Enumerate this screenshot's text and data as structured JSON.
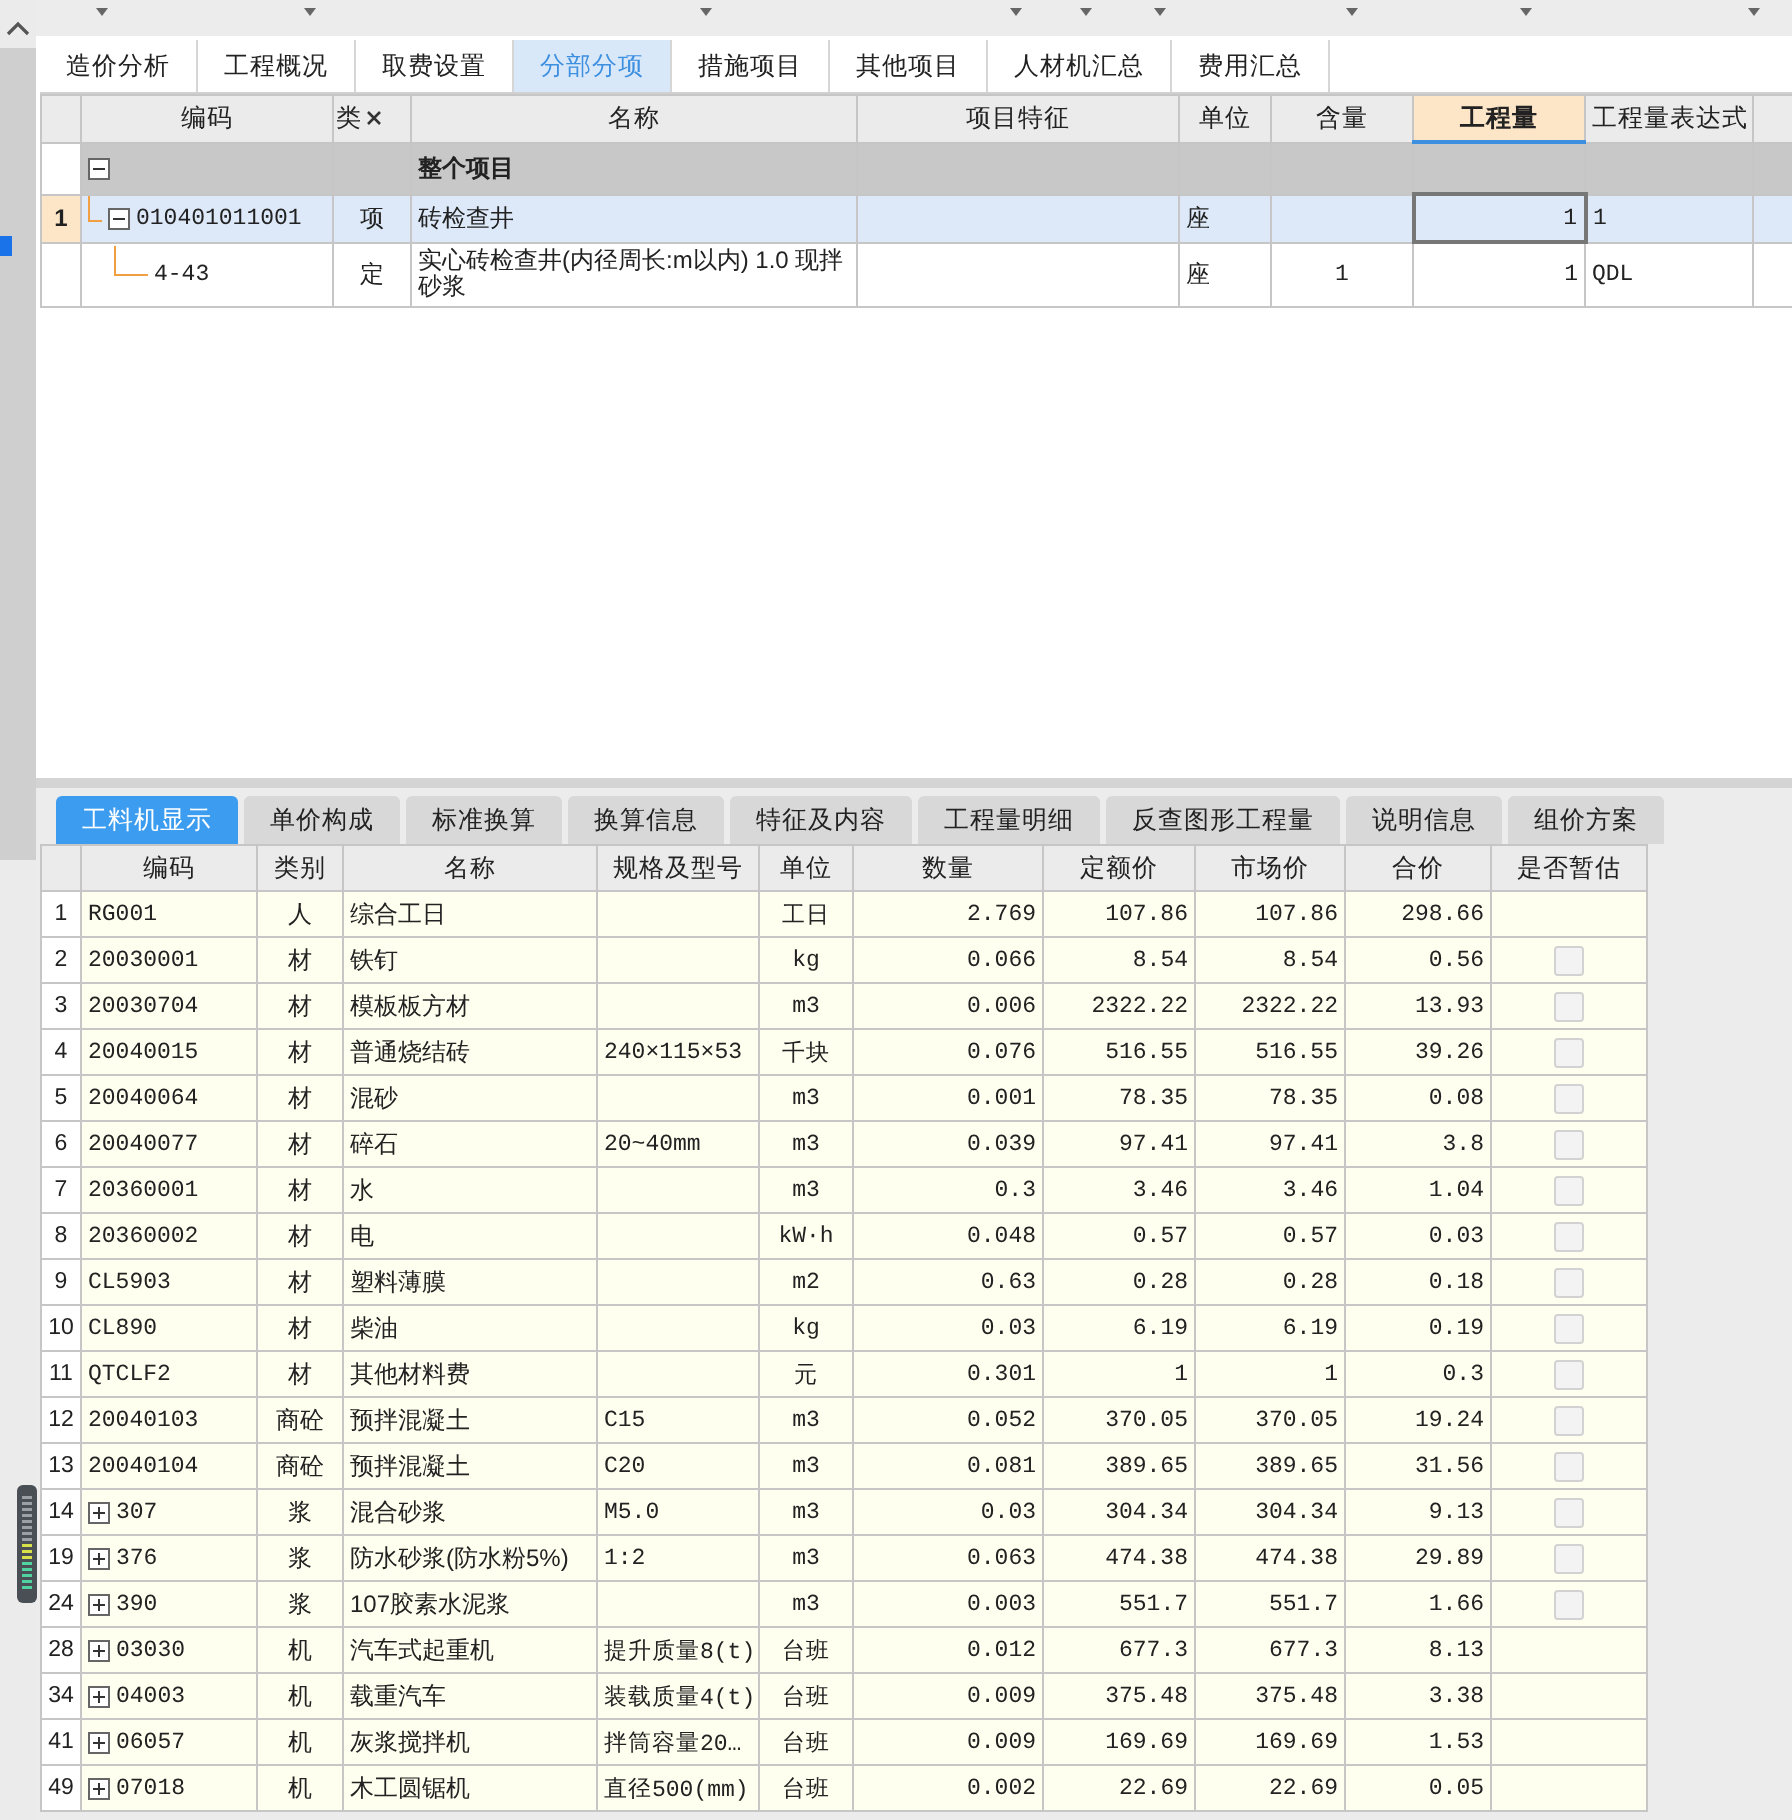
{
  "top_tabs": [
    {
      "label": "造价分析",
      "selected": false
    },
    {
      "label": "工程概况",
      "selected": false
    },
    {
      "label": "取费设置",
      "selected": false
    },
    {
      "label": "分部分项",
      "selected": true
    },
    {
      "label": "措施项目",
      "selected": false
    },
    {
      "label": "其他项目",
      "selected": false
    },
    {
      "label": "人材机汇总",
      "selected": false
    },
    {
      "label": "费用汇总",
      "selected": false
    }
  ],
  "upper_grid": {
    "columns": [
      {
        "label": "编码",
        "selected": false,
        "closable": false
      },
      {
        "label": "类",
        "selected": false,
        "closable": true
      },
      {
        "label": "名称",
        "selected": false,
        "closable": false
      },
      {
        "label": "项目特征",
        "selected": false,
        "closable": false
      },
      {
        "label": "单位",
        "selected": false,
        "closable": false
      },
      {
        "label": "含量",
        "selected": false,
        "closable": false
      },
      {
        "label": "工程量",
        "selected": true,
        "closable": false
      },
      {
        "label": "工程量表达式",
        "selected": false,
        "closable": false
      }
    ],
    "rows": [
      {
        "kind": "group",
        "expanded": true,
        "selected": false,
        "name": "整个项目"
      },
      {
        "kind": "item",
        "expanded": true,
        "selected": true,
        "row_number": "1",
        "code": "010401011001",
        "type": "项",
        "name": "砖检查井",
        "unit": "座",
        "quantity": "1",
        "expression": "1"
      },
      {
        "kind": "child",
        "selected": false,
        "code": "4-43",
        "type": "定",
        "name": "实心砖检查井(内径周长:m以内) 1.0 现拌砂浆",
        "unit": "座",
        "content": "1",
        "quantity": "1",
        "expression": "QDL"
      }
    ]
  },
  "bottom_tabs": [
    {
      "label": "工料机显示",
      "selected": true
    },
    {
      "label": "单价构成",
      "selected": false
    },
    {
      "label": "标准换算",
      "selected": false
    },
    {
      "label": "换算信息",
      "selected": false
    },
    {
      "label": "特征及内容",
      "selected": false
    },
    {
      "label": "工程量明细",
      "selected": false
    },
    {
      "label": "反查图形工程量",
      "selected": false
    },
    {
      "label": "说明信息",
      "selected": false
    },
    {
      "label": "组价方案",
      "selected": false
    }
  ],
  "lower_grid": {
    "columns": [
      "编码",
      "类别",
      "名称",
      "规格及型号",
      "单位",
      "数量",
      "定额价",
      "市场价",
      "合价",
      "是否暂估"
    ],
    "rows": [
      {
        "number": "1",
        "code": "RG001",
        "type": "人",
        "name": "综合工日",
        "unit": "工日",
        "amount": "2.769",
        "quota_price": "107.86",
        "market_price": "107.86",
        "total": "298.66"
      },
      {
        "number": "2",
        "code": "20030001",
        "type": "材",
        "name": "铁钉",
        "unit": "kg",
        "amount": "0.066",
        "quota_price": "8.54",
        "market_price": "8.54",
        "total": "0.56",
        "checkbox": {
          "checked": false
        }
      },
      {
        "number": "3",
        "code": "20030704",
        "type": "材",
        "name": "模板板方材",
        "unit": "m3",
        "amount": "0.006",
        "quota_price": "2322.22",
        "market_price": "2322.22",
        "total": "13.93",
        "checkbox": {
          "checked": false
        }
      },
      {
        "number": "4",
        "code": "20040015",
        "type": "材",
        "name": "普通烧结砖",
        "spec": "240×115×53",
        "unit": "千块",
        "amount": "0.076",
        "quota_price": "516.55",
        "market_price": "516.55",
        "total": "39.26",
        "checkbox": {
          "checked": false
        }
      },
      {
        "number": "5",
        "code": "20040064",
        "type": "材",
        "name": "混砂",
        "unit": "m3",
        "amount": "0.001",
        "quota_price": "78.35",
        "market_price": "78.35",
        "total": "0.08",
        "checkbox": {
          "checked": false
        }
      },
      {
        "number": "6",
        "code": "20040077",
        "type": "材",
        "name": "碎石",
        "spec": "20~40mm",
        "unit": "m3",
        "amount": "0.039",
        "quota_price": "97.41",
        "market_price": "97.41",
        "total": "3.8",
        "checkbox": {
          "checked": false
        }
      },
      {
        "number": "7",
        "code": "20360001",
        "type": "材",
        "name": "水",
        "unit": "m3",
        "amount": "0.3",
        "quota_price": "3.46",
        "market_price": "3.46",
        "total": "1.04",
        "checkbox": {
          "checked": false
        }
      },
      {
        "number": "8",
        "code": "20360002",
        "type": "材",
        "name": "电",
        "unit": "kW·h",
        "amount": "0.048",
        "quota_price": "0.57",
        "market_price": "0.57",
        "total": "0.03",
        "checkbox": {
          "checked": false
        }
      },
      {
        "number": "9",
        "code": "CL5903",
        "type": "材",
        "name": "塑料薄膜",
        "unit": "m2",
        "amount": "0.63",
        "quota_price": "0.28",
        "market_price": "0.28",
        "total": "0.18",
        "checkbox": {
          "checked": false
        }
      },
      {
        "number": "10",
        "code": "CL890",
        "type": "材",
        "name": "柴油",
        "unit": "kg",
        "amount": "0.03",
        "quota_price": "6.19",
        "market_price": "6.19",
        "total": "0.19",
        "checkbox": {
          "checked": false
        }
      },
      {
        "number": "11",
        "code": "QTCLF2",
        "type": "材",
        "name": "其他材料费",
        "unit": "元",
        "amount": "0.301",
        "quota_price": "1",
        "market_price": "1",
        "total": "0.3",
        "checkbox": {
          "checked": false
        }
      },
      {
        "number": "12",
        "code": "20040103",
        "type": "商砼",
        "name": "预拌混凝土",
        "spec": "C15",
        "unit": "m3",
        "amount": "0.052",
        "quota_price": "370.05",
        "market_price": "370.05",
        "total": "19.24",
        "checkbox": {
          "checked": false
        }
      },
      {
        "number": "13",
        "code": "20040104",
        "type": "商砼",
        "name": "预拌混凝土",
        "spec": "C20",
        "unit": "m3",
        "amount": "0.081",
        "quota_price": "389.65",
        "market_price": "389.65",
        "total": "31.56",
        "checkbox": {
          "checked": false
        }
      },
      {
        "number": "14",
        "expanded": false,
        "code": "307",
        "type": "浆",
        "name": "混合砂浆",
        "spec": "M5.0",
        "unit": "m3",
        "amount": "0.03",
        "quota_price": "304.34",
        "market_price": "304.34",
        "total": "9.13",
        "checkbox": {
          "checked": false
        }
      },
      {
        "number": "19",
        "expanded": false,
        "code": "376",
        "type": "浆",
        "name": "防水砂浆(防水粉5%)",
        "spec": "1:2",
        "unit": "m3",
        "amount": "0.063",
        "quota_price": "474.38",
        "market_price": "474.38",
        "total": "29.89",
        "checkbox": {
          "checked": false
        }
      },
      {
        "number": "24",
        "expanded": false,
        "code": "390",
        "type": "浆",
        "name": "107胶素水泥浆",
        "unit": "m3",
        "amount": "0.003",
        "quota_price": "551.7",
        "market_price": "551.7",
        "total": "1.66",
        "checkbox": {
          "checked": false
        }
      },
      {
        "number": "28",
        "expanded": false,
        "code": "03030",
        "type": "机",
        "name": "汽车式起重机",
        "spec": "提升质量8(t)",
        "unit": "台班",
        "amount": "0.012",
        "quota_price": "677.3",
        "market_price": "677.3",
        "total": "8.13"
      },
      {
        "number": "34",
        "expanded": false,
        "code": "04003",
        "type": "机",
        "name": "载重汽车",
        "spec": "装载质量4(t)",
        "unit": "台班",
        "amount": "0.009",
        "quota_price": "375.48",
        "market_price": "375.48",
        "total": "3.38"
      },
      {
        "number": "41",
        "expanded": false,
        "code": "06057",
        "type": "机",
        "name": "灰浆搅拌机",
        "spec": "拌筒容量20…",
        "unit": "台班",
        "amount": "0.009",
        "quota_price": "169.69",
        "market_price": "169.69",
        "total": "1.53"
      },
      {
        "number": "49",
        "expanded": false,
        "code": "07018",
        "type": "机",
        "name": "木工圆锯机",
        "spec": "直径500(mm)",
        "unit": "台班",
        "amount": "0.002",
        "quota_price": "22.69",
        "market_price": "22.69",
        "total": "0.05"
      }
    ]
  }
}
